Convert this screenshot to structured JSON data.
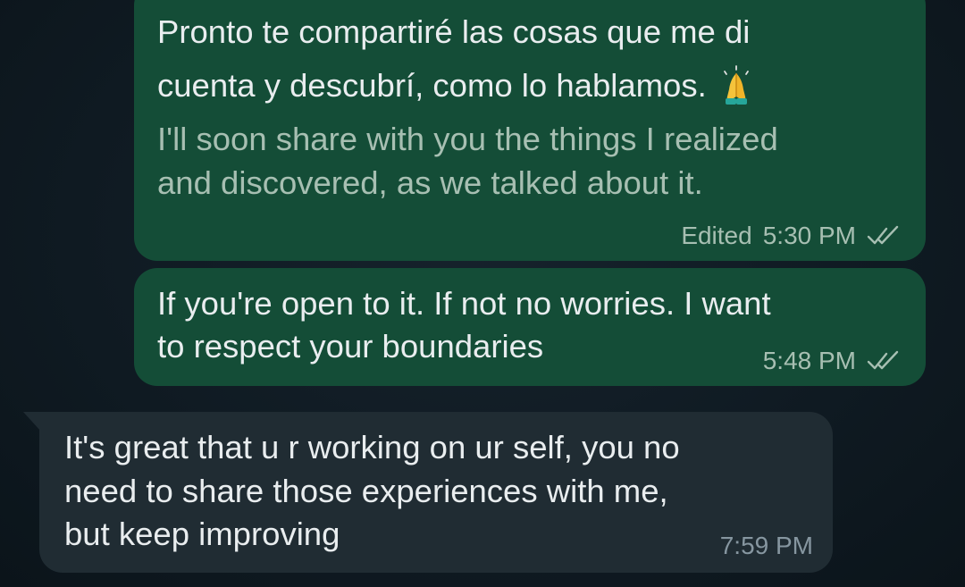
{
  "messages": [
    {
      "direction": "outgoing",
      "text_lines": [
        "Pronto te compartiré las cosas que me di",
        "cuenta y descubrí, como lo hablamos."
      ],
      "emoji": "folded-hands",
      "translation_lines": [
        "I'll soon share with you the things I realized",
        "and discovered, as we talked about it."
      ],
      "edited_label": "Edited",
      "time": "5:30 PM",
      "status": "read"
    },
    {
      "direction": "outgoing",
      "text_lines": [
        "If you're open to it. If not no worries. I want",
        "to respect your boundaries"
      ],
      "time": "5:48 PM",
      "status": "read"
    },
    {
      "direction": "incoming",
      "text_lines": [
        "It's great that u r working on ur self, you no",
        "need to share those experiences with me,",
        "but keep improving"
      ],
      "time": "7:59 PM"
    }
  ],
  "colors": {
    "background": "#0f1a22",
    "outgoing_bubble": "#144d37",
    "incoming_bubble": "#202c33",
    "text": "#e9edef",
    "meta_text": "#a7bfb2"
  },
  "icons": {
    "read_receipt": "double-check-icon",
    "emoji": "folded-hands-emoji"
  }
}
